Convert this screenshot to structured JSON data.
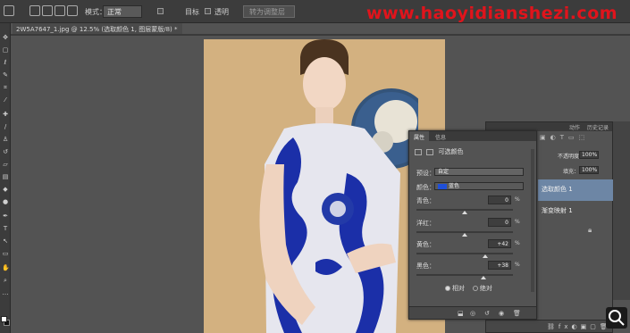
{
  "watermark": "www.haoyidianshezi.com",
  "options_bar": {
    "mode_label": "模式：",
    "mode_value": "正常",
    "checkbox1_label": "目标",
    "checkbox2_label": "透明",
    "button_label": "转为调整层"
  },
  "document": {
    "tab_title": "2W5A7647_1.jpg @ 12.5% (选取颜色 1, 图层蒙版/8) *"
  },
  "properties_panel": {
    "tabs": [
      "属性",
      "信息"
    ],
    "header": "可选颜色",
    "preset_label": "预设：",
    "preset_value": "自定",
    "colors_label": "颜色：",
    "colors_value": "蓝色",
    "sliders": [
      {
        "name": "青色：",
        "value": "0",
        "unit": "%",
        "level": 0
      },
      {
        "name": "洋红：",
        "value": "0",
        "unit": "%",
        "level": 0
      },
      {
        "name": "黄色：",
        "value": "+42",
        "unit": "%",
        "level": 42
      },
      {
        "name": "黑色：",
        "value": "+38",
        "unit": "%",
        "level": 38
      }
    ],
    "method_relative": "相对",
    "method_absolute": "绝对"
  },
  "layers_panel": {
    "tabs": [
      "动作",
      "历史记录"
    ],
    "opacity_label": "不透明度：",
    "opacity_value": "100%",
    "fill_label": "填充：",
    "fill_value": "100%",
    "items": [
      {
        "label": "选取颜色 1",
        "selected": true
      },
      {
        "label": "渐变映射 1",
        "selected": false
      }
    ]
  },
  "colors": {
    "blue_swatch": "#1f4fd8",
    "selected_layer": "#6d86a5",
    "photo_bg": "#d3b180"
  }
}
